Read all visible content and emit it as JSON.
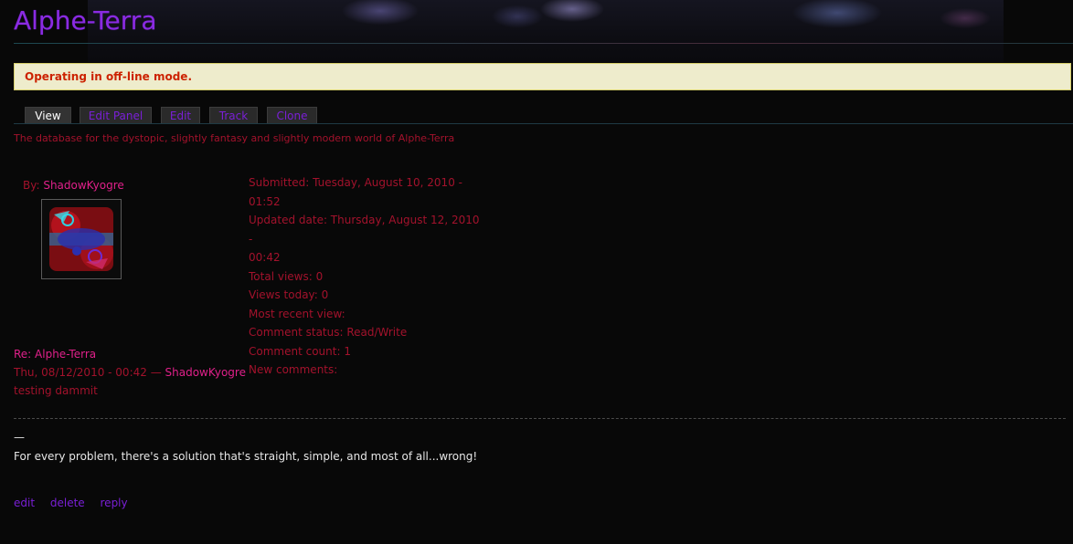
{
  "site": {
    "title": "Alphe-Terra"
  },
  "status": {
    "message": "Operating in off-line mode."
  },
  "tabs": [
    {
      "label": "View",
      "active": true
    },
    {
      "label": "Edit Panel",
      "active": false
    },
    {
      "label": "Edit",
      "active": false
    },
    {
      "label": "Track",
      "active": false
    },
    {
      "label": "Clone",
      "active": false
    }
  ],
  "description": "The database for the dystopic, slightly fantasy and slightly modern world of Alphe-Terra",
  "author": {
    "prefix": "By: ",
    "name": "ShadowKyogre"
  },
  "meta": {
    "submitted": "Submitted: Tuesday, August 10, 2010 - 01:52",
    "updated_1": "Updated date: Thursday, August 12, 2010 -",
    "updated_2": "00:42",
    "total_views": "Total views: 0",
    "views_today": "Views today: 0",
    "recent_view": "Most recent view:",
    "comment_status": "Comment status: Read/Write",
    "comment_count": "Comment count: 1",
    "new_comments": "New comments:"
  },
  "comment": {
    "title": "Re: Alphe-Terra",
    "date": "Thu, 08/12/2010 - 00:42 — ",
    "author": "ShadowKyogre",
    "body": "testing dammit",
    "sig_dash": "—",
    "signature": "For every problem, there's a solution that's straight, simple, and most of all...wrong!",
    "links": {
      "edit": "edit",
      "delete": "delete",
      "reply": "reply"
    }
  },
  "colors": {
    "title": "#8a2be2",
    "text_red": "#a3122c",
    "link_pink": "#e0208a",
    "link_purple": "#7a1fd6",
    "status_bg": "#eeeccc",
    "status_text": "#cc2200"
  }
}
